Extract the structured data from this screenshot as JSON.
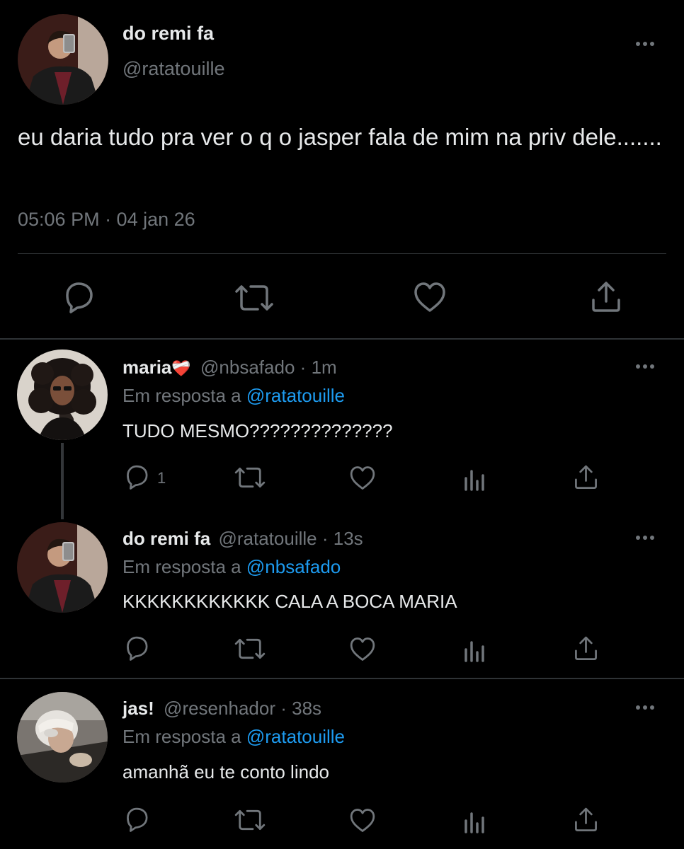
{
  "main_tweet": {
    "display_name": "do remi fa",
    "handle": "@ratatouille",
    "text": "eu daria tudo pra ver o q o jasper fala de mim na priv dele.......",
    "timestamp": "05:06 PM · 04 jan 26",
    "more_icon": "ellipsis-icon",
    "actions": [
      "reply-icon",
      "retweet-icon",
      "like-icon",
      "share-icon"
    ]
  },
  "replies": [
    {
      "display_name": "maria",
      "emoji": "❤️‍🩹",
      "handle": "@nbsafado",
      "time": "1m",
      "separator": "·",
      "in_reply_prefix": "Em resposta a",
      "in_reply_to": "@ratatouille",
      "text": "TUDO MESMO??????????????",
      "reply_count": "1"
    },
    {
      "display_name": "do remi fa",
      "handle": "@ratatouille",
      "time": "13s",
      "separator": "·",
      "in_reply_prefix": "Em resposta a",
      "in_reply_to": "@nbsafado",
      "text": "KKKKKKKKKKKK CALA A BOCA MARIA"
    },
    {
      "display_name": "jas!",
      "handle": "@resenhador",
      "time": "38s",
      "separator": "·",
      "in_reply_prefix": "Em resposta a",
      "in_reply_to": "@ratatouille",
      "text": "amanhã eu te conto lindo"
    }
  ],
  "colors": {
    "background": "#000000",
    "text": "#e7e9ea",
    "secondary": "#71767b",
    "link": "#1d9bf0",
    "divider": "#2f3336"
  }
}
